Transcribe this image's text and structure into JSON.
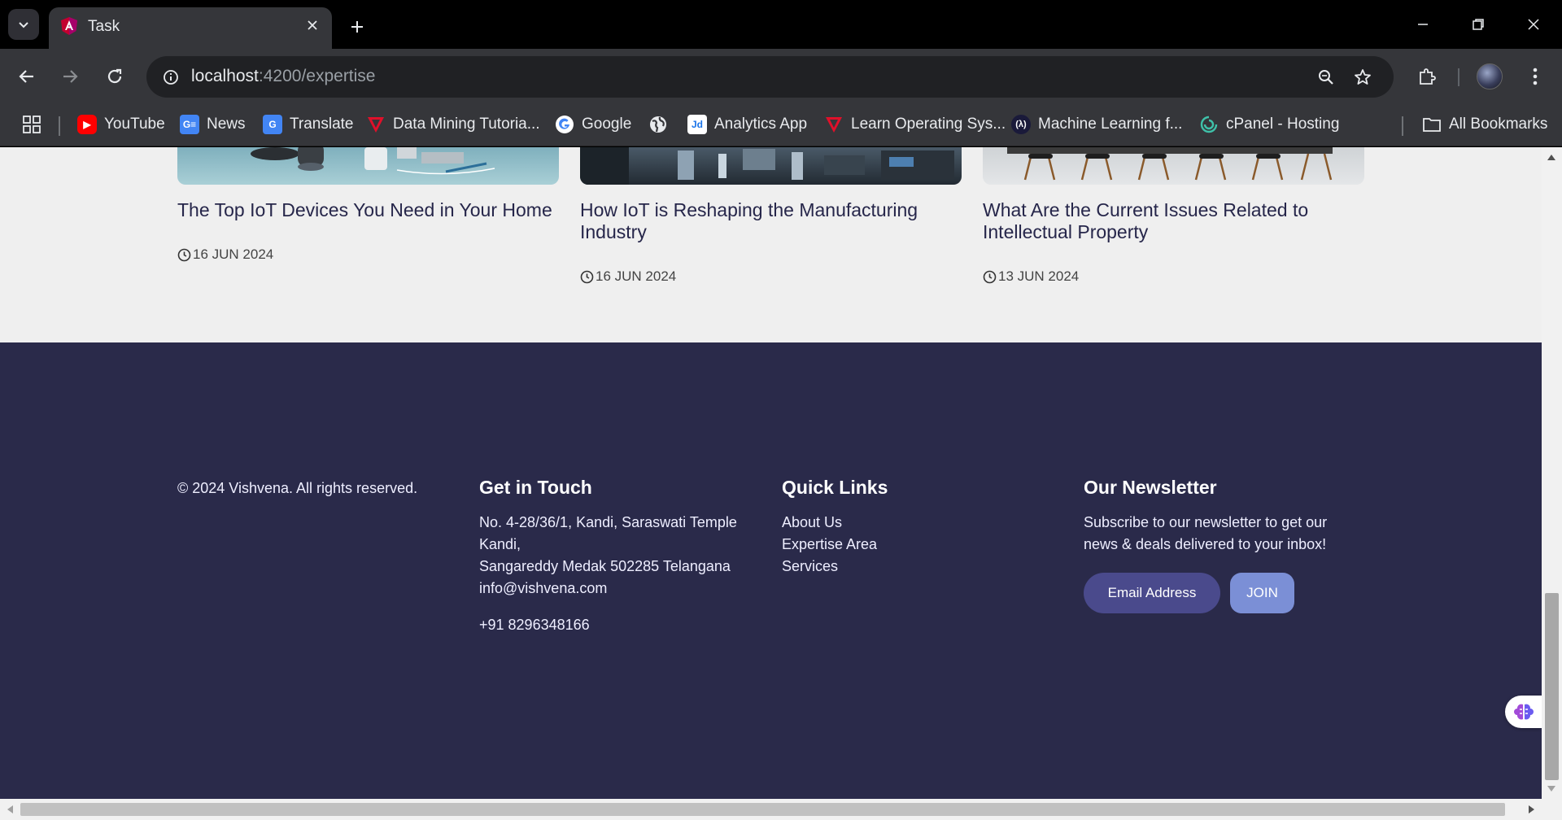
{
  "browser": {
    "tab_title": "Task",
    "url_host": "localhost",
    "url_rest": ":4200/expertise",
    "bookmarks": [
      {
        "label": "YouTube",
        "icon": "youtube-icon"
      },
      {
        "label": "News",
        "icon": "google-news-icon"
      },
      {
        "label": "Translate",
        "icon": "google-translate-icon"
      },
      {
        "label": "Data Mining Tutoria...",
        "icon": "red-v-icon"
      },
      {
        "label": "Google",
        "icon": "google-icon"
      },
      {
        "label": "",
        "icon": "globe-icon"
      },
      {
        "label": "Analytics App",
        "icon": "jd-icon"
      },
      {
        "label": "Learn Operating Sys...",
        "icon": "red-v-icon"
      },
      {
        "label": "Machine Learning f...",
        "icon": "ml-icon"
      },
      {
        "label": "cPanel - Hosting",
        "icon": "cpanel-icon"
      }
    ],
    "all_bookmarks": "All Bookmarks"
  },
  "cards": [
    {
      "title": "The Top IoT Devices You Need in Your Home",
      "date": "16 JUN 2024"
    },
    {
      "title": "How IoT is Reshaping the Manufacturing Industry",
      "date": "16 JUN 2024"
    },
    {
      "title": "What Are the Current Issues Related to Intellectual Property",
      "date": "13 JUN 2024"
    }
  ],
  "footer": {
    "copyright": "© 2024 Vishvena. All rights reserved.",
    "contact": {
      "heading": "Get in Touch",
      "address_line1": "No. 4-28/36/1, Kandi, Saraswati Temple",
      "address_line2": "Kandi,",
      "address_line3": "Sangareddy Medak 502285 Telangana",
      "email": "info@vishvena.com",
      "phone": "+91 8296348166"
    },
    "quick_links": {
      "heading": "Quick Links",
      "items": [
        "About Us",
        "Expertise Area",
        "Services"
      ]
    },
    "newsletter": {
      "heading": "Our Newsletter",
      "text_line1": "Subscribe to our newsletter to get our",
      "text_line2": "news & deals delivered to your inbox!",
      "email_button": "Email Address",
      "join_button": "JOIN"
    }
  },
  "colors": {
    "footer_bg": "#2a2a4a",
    "page_bg": "#efefef",
    "join_btn": "#7b8fd6",
    "email_btn": "#4a4a8c"
  }
}
